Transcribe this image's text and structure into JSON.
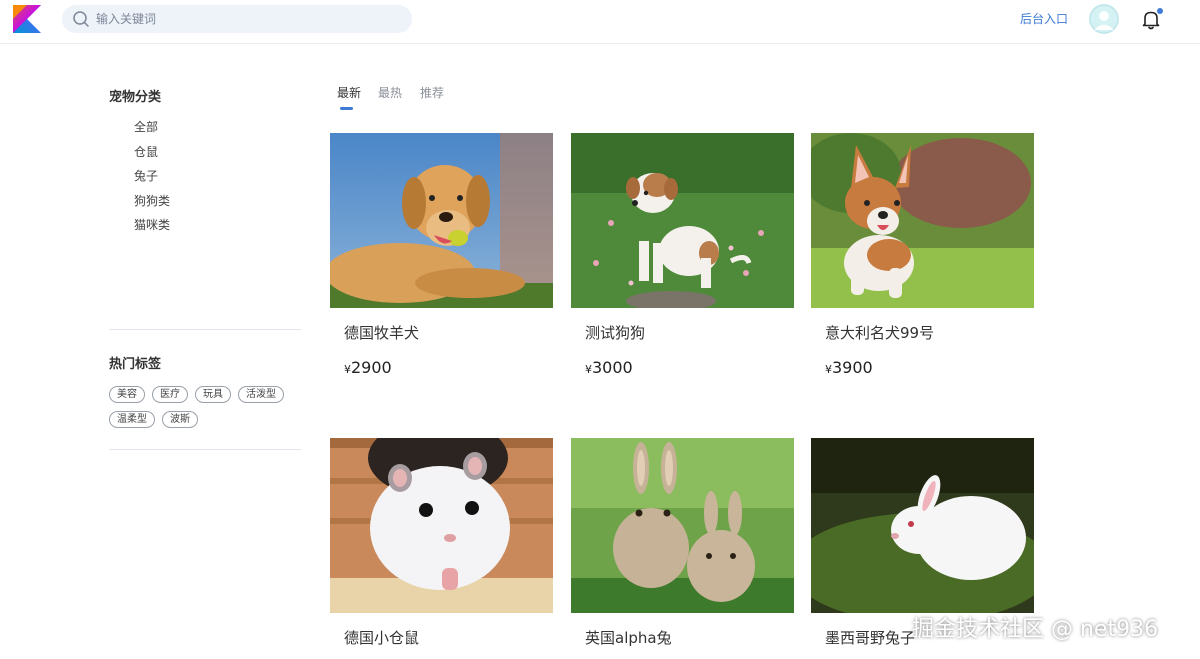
{
  "header": {
    "logo_icon": "kotlin-k-logo",
    "search": {
      "placeholder": "输入关键词",
      "value": "",
      "icon": "search-icon"
    },
    "admin_link": "后台入口",
    "avatar_icon": "user-avatar-icon",
    "bell_icon": "bell-icon",
    "accent_color": "#3d7bd6"
  },
  "sidebar": {
    "category_title": "宠物分类",
    "categories": [
      "全部",
      "仓鼠",
      "兔子",
      "狗狗类",
      "猫咪类"
    ],
    "tags_title": "热门标签",
    "tags": [
      "美容",
      "医疗",
      "玩具",
      "活泼型",
      "温柔型",
      "波斯"
    ]
  },
  "tabs": [
    {
      "label": "最新",
      "active": true
    },
    {
      "label": "最热",
      "active": false
    },
    {
      "label": "推荐",
      "active": false
    }
  ],
  "products": [
    {
      "name": "德国牧羊犬",
      "currency": "¥",
      "price": "2900",
      "image": "golden-dog-photo"
    },
    {
      "name": "测试狗狗",
      "currency": "¥",
      "price": "3000",
      "image": "puppy-grass-photo"
    },
    {
      "name": "意大利名犬99号",
      "currency": "¥",
      "price": "3900",
      "image": "corgi-photo"
    },
    {
      "name": "德国小仓鼠",
      "currency": "",
      "price": "",
      "image": "hamster-photo"
    },
    {
      "name": "英国alpha兔",
      "currency": "",
      "price": "",
      "image": "rabbits-photo"
    },
    {
      "name": "墨西哥野兔子",
      "currency": "",
      "price": "",
      "image": "white-rabbit-photo"
    }
  ],
  "watermark": "掘金技术社区 @ net936"
}
